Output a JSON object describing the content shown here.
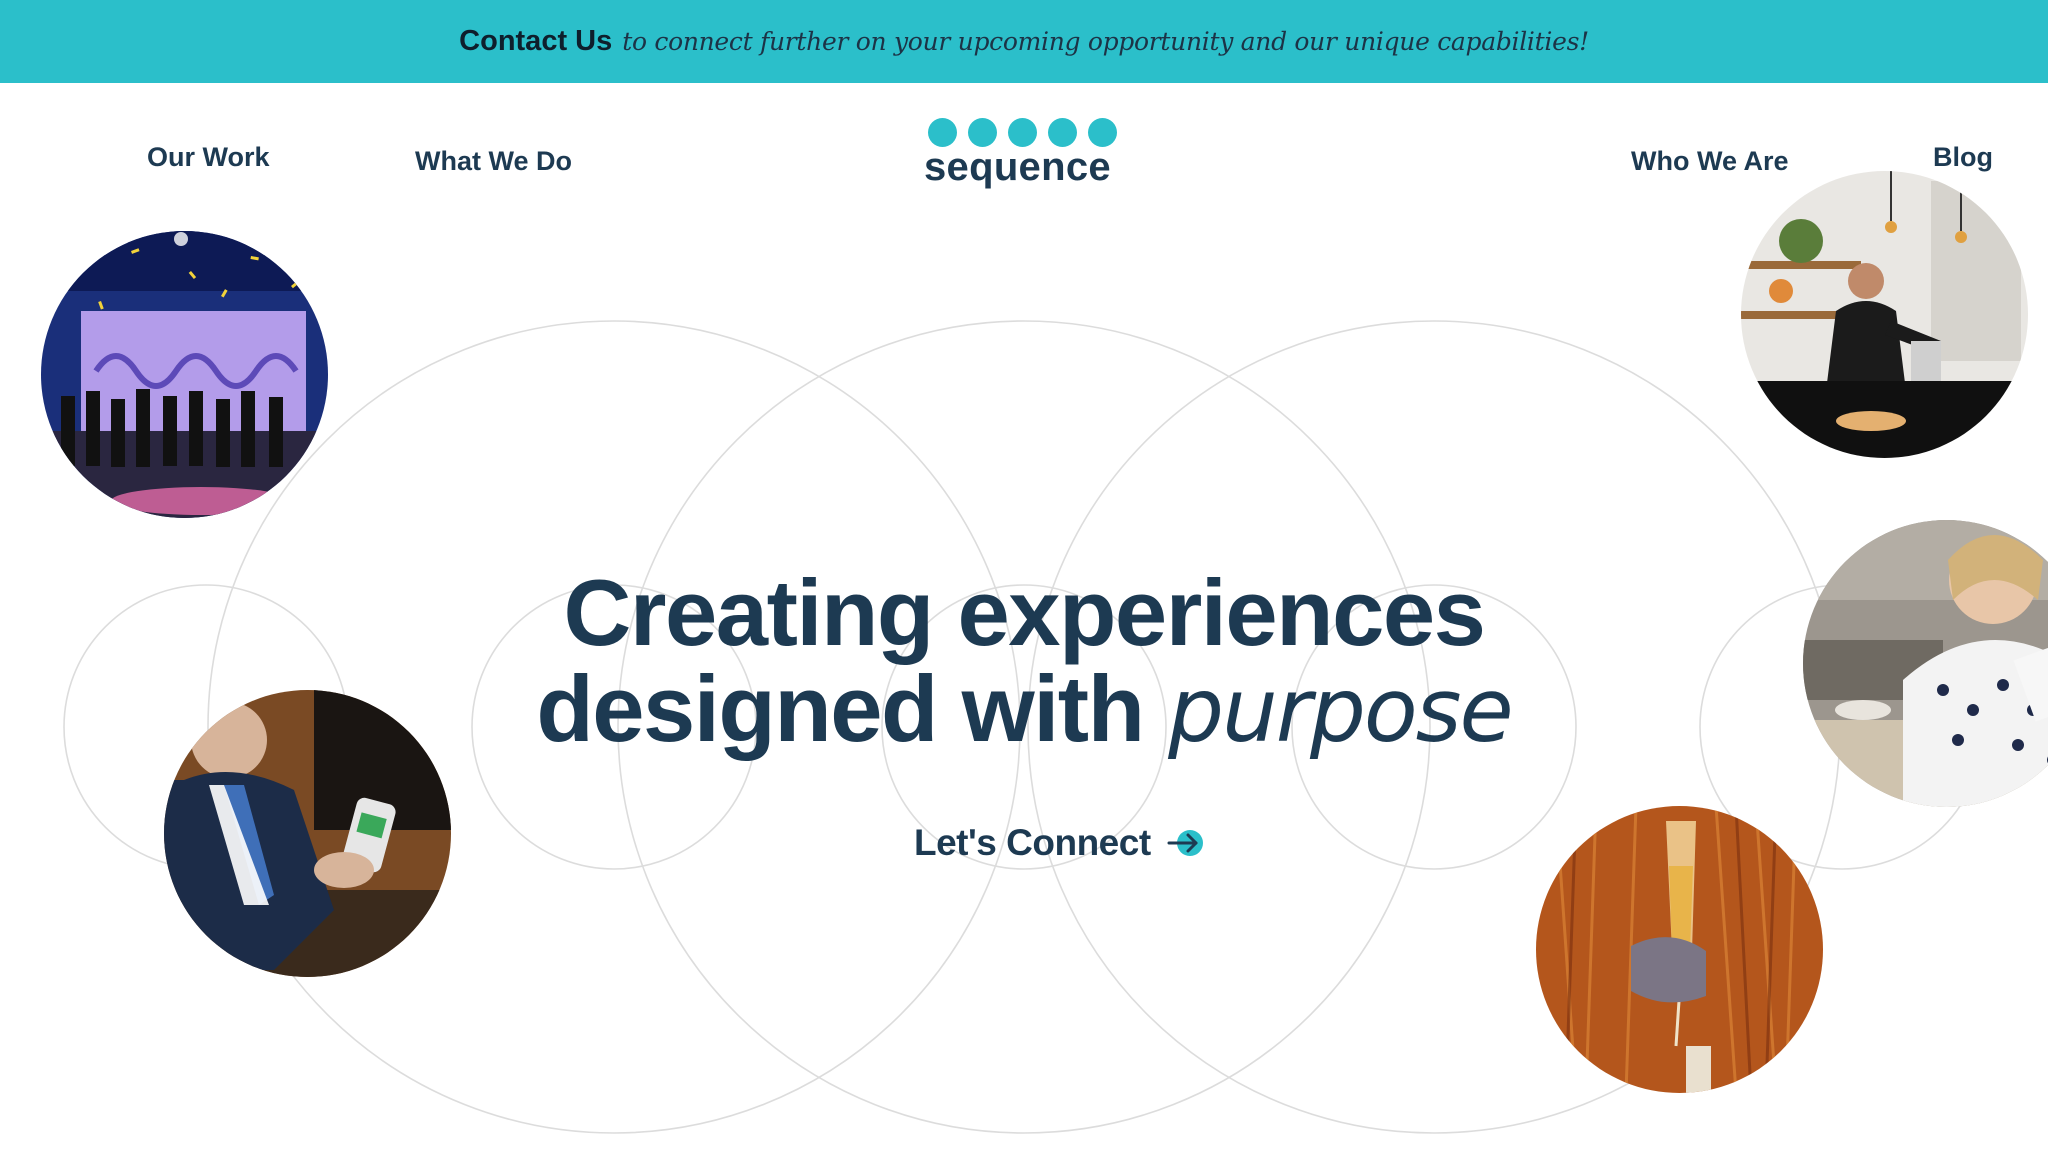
{
  "banner": {
    "contact_label": "Contact Us",
    "text": "to connect further on your upcoming opportunity and our unique capabilities!",
    "color": "#2bbfca"
  },
  "nav": {
    "our_work": "Our Work",
    "what_we_do": "What We Do",
    "who_we_are": "Who We Are",
    "blog": "Blog"
  },
  "logo": {
    "word": "sequence",
    "dot_count": 5,
    "dot_color": "#2bbfca"
  },
  "hero": {
    "line1": "Creating experiences",
    "line2_bold": "designed with",
    "line2_italic": "purpose",
    "text_color": "#1d3a52"
  },
  "cta": {
    "label": "Let's Connect",
    "icon": "arrow-right-circle-icon"
  }
}
